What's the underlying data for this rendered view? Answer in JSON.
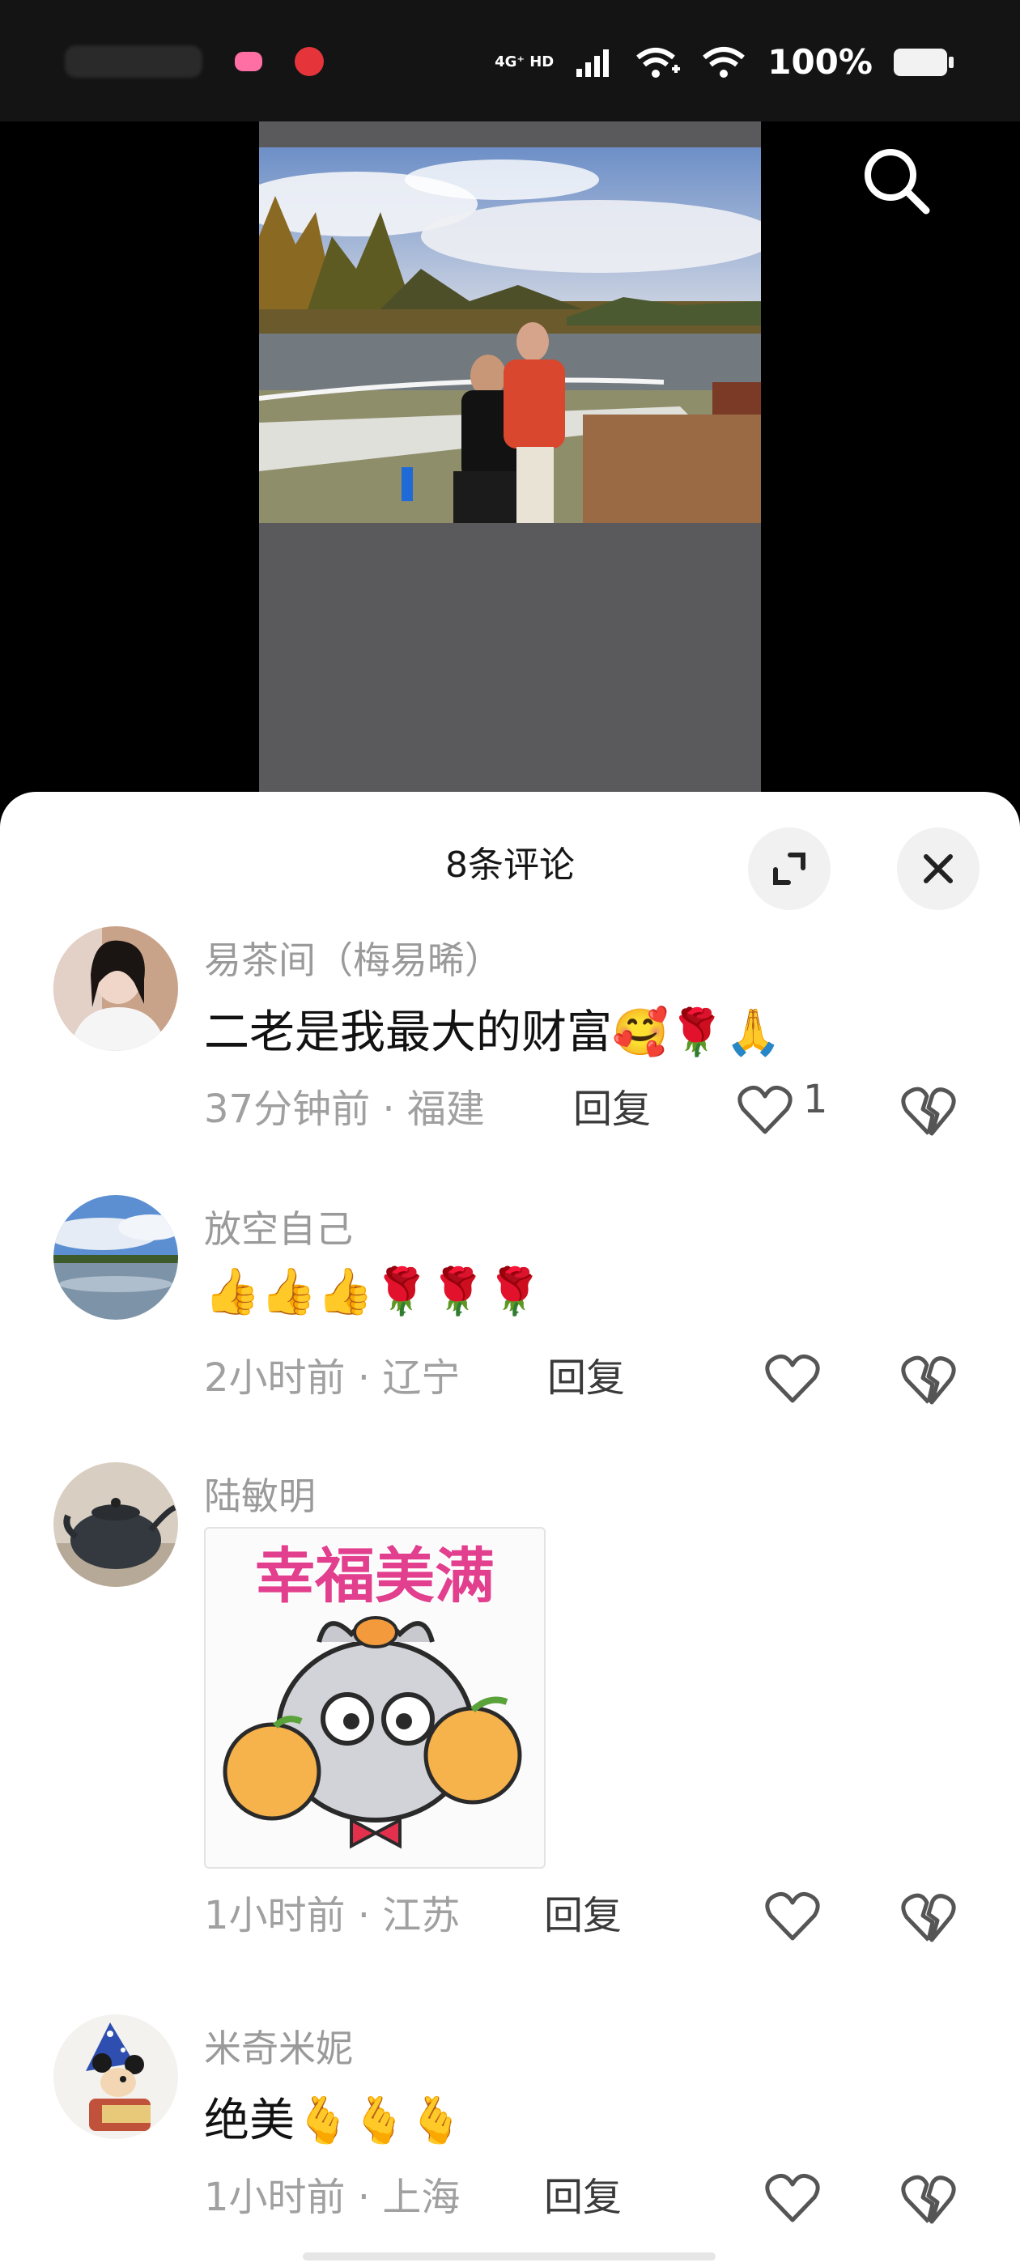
{
  "status_bar": {
    "network": "4G⁺ HD",
    "battery": "100%"
  },
  "sheet": {
    "title": "8条评论"
  },
  "comments": [
    {
      "name": "易茶间（梅易晞）",
      "text": "二老是我最大的财富",
      "emojis": "🥰🌹🙏",
      "time": "37分钟前 · 福建",
      "reply": "回复",
      "likes": "1"
    },
    {
      "name": "放空自己",
      "text": "",
      "emojis": "👍👍👍🌹🌹🌹",
      "time": "2小时前 · 辽宁",
      "reply": "回复",
      "likes": ""
    },
    {
      "name": "陆敏明",
      "sticker_text": "幸福美满",
      "time": "1小时前 · 江苏",
      "reply": "回复",
      "likes": ""
    },
    {
      "name": "米奇米妮",
      "text": "绝美",
      "emojis": "🫰🫰🫰",
      "time": "1小时前 · 上海",
      "reply": "回复",
      "likes": ""
    }
  ],
  "icons": {
    "search": "search-icon",
    "expand": "expand-icon",
    "close": "close-icon",
    "like": "heart-icon",
    "dislike": "broken-heart-icon"
  }
}
